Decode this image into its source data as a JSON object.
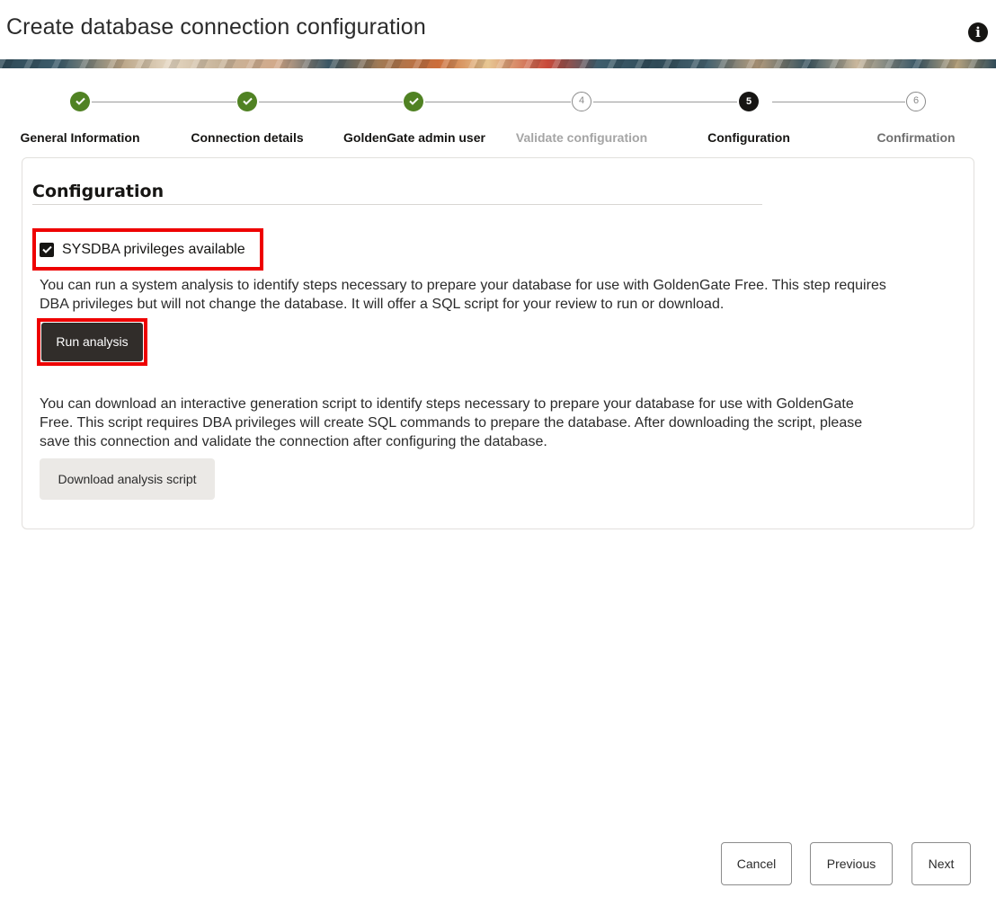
{
  "header": {
    "title": "Create database connection configuration",
    "info_icon": "i"
  },
  "steps": [
    {
      "label": "General Information",
      "state": "complete"
    },
    {
      "label": "Connection details",
      "state": "complete"
    },
    {
      "label": "GoldenGate admin user",
      "state": "complete"
    },
    {
      "label": "Validate configuration",
      "state": "disabled",
      "number": "4"
    },
    {
      "label": "Configuration",
      "state": "current",
      "number": "5"
    },
    {
      "label": "Confirmation",
      "state": "future",
      "number": "6"
    }
  ],
  "configuration": {
    "heading": "Configuration",
    "sysdba_checkbox": {
      "label": "SYSDBA privileges available",
      "checked": true
    },
    "analysis_text_line1": "You can run a system analysis to identify steps necessary to prepare your database for use with GoldenGate Free. This step requires",
    "analysis_text_line2": "DBA privileges but will not change the database. It will offer a SQL script for your review to run or download.",
    "run_analysis_label": "Run analysis",
    "download_text_line1": "You can download an interactive generation script to identify steps necessary to prepare your database for use with GoldenGate",
    "download_text_line2": "Free. This script requires DBA privileges will create SQL commands to prepare the database. After downloading the script, please",
    "download_text_line3": "save this connection and validate the connection after configuring the database.",
    "download_script_label": "Download analysis script"
  },
  "footer": {
    "cancel_label": "Cancel",
    "previous_label": "Previous",
    "next_label": "Next"
  },
  "colors": {
    "highlight": "#ee0000",
    "complete": "#508223",
    "current": "#161513",
    "primary_button": "#312d2a"
  }
}
